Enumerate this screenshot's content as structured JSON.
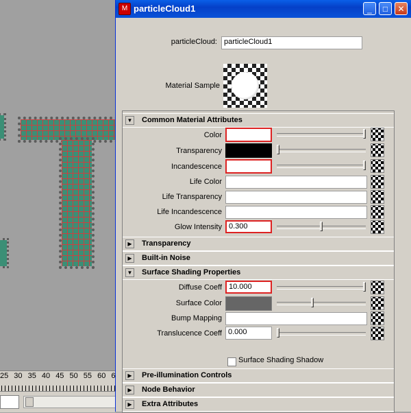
{
  "window": {
    "title": "particleCloud1",
    "minimize_label": "_",
    "maximize_label": "□",
    "close_label": "✕"
  },
  "header": {
    "name_label": "particleCloud:",
    "name_value": "particleCloud1",
    "sample_label": "Material Sample"
  },
  "sections": {
    "common": "Common Material Attributes",
    "transparency": "Transparency",
    "noise": "Built-in Noise",
    "surface": "Surface Shading Properties",
    "preillum": "Pre-illumination Controls",
    "node": "Node Behavior",
    "extra": "Extra Attributes"
  },
  "common": {
    "color": "Color",
    "transparency": "Transparency",
    "incandescence": "Incandescence",
    "life_color": "Life Color",
    "life_transparency": "Life Transparency",
    "life_incandescence": "Life Incandescence",
    "glow_intensity": "Glow Intensity",
    "glow_value": "0.300",
    "swatch_colors": {
      "color": "#ffffff",
      "transparency": "#000000",
      "incandescence": "#ffffff"
    },
    "slider_levels": {
      "color": 1.0,
      "transparency": 0.0,
      "incandescence": 1.0,
      "glow": 0.5
    }
  },
  "surface": {
    "diffuse_coeff": "Diffuse Coeff",
    "diffuse_value": "10.000",
    "surface_color": "Surface Color",
    "surface_swatch": "#666666",
    "bump_mapping": "Bump Mapping",
    "translucence_coeff": "Translucence Coeff",
    "translucence_value": "0.000",
    "shading_shadow": "Surface Shading Shadow",
    "slider_levels": {
      "diffuse": 1.0,
      "surface_color": 0.4,
      "translucence": 0.0
    }
  },
  "timeline": {
    "ticks": [
      "25",
      "30",
      "35",
      "40",
      "45",
      "50",
      "55",
      "60",
      "6"
    ]
  }
}
